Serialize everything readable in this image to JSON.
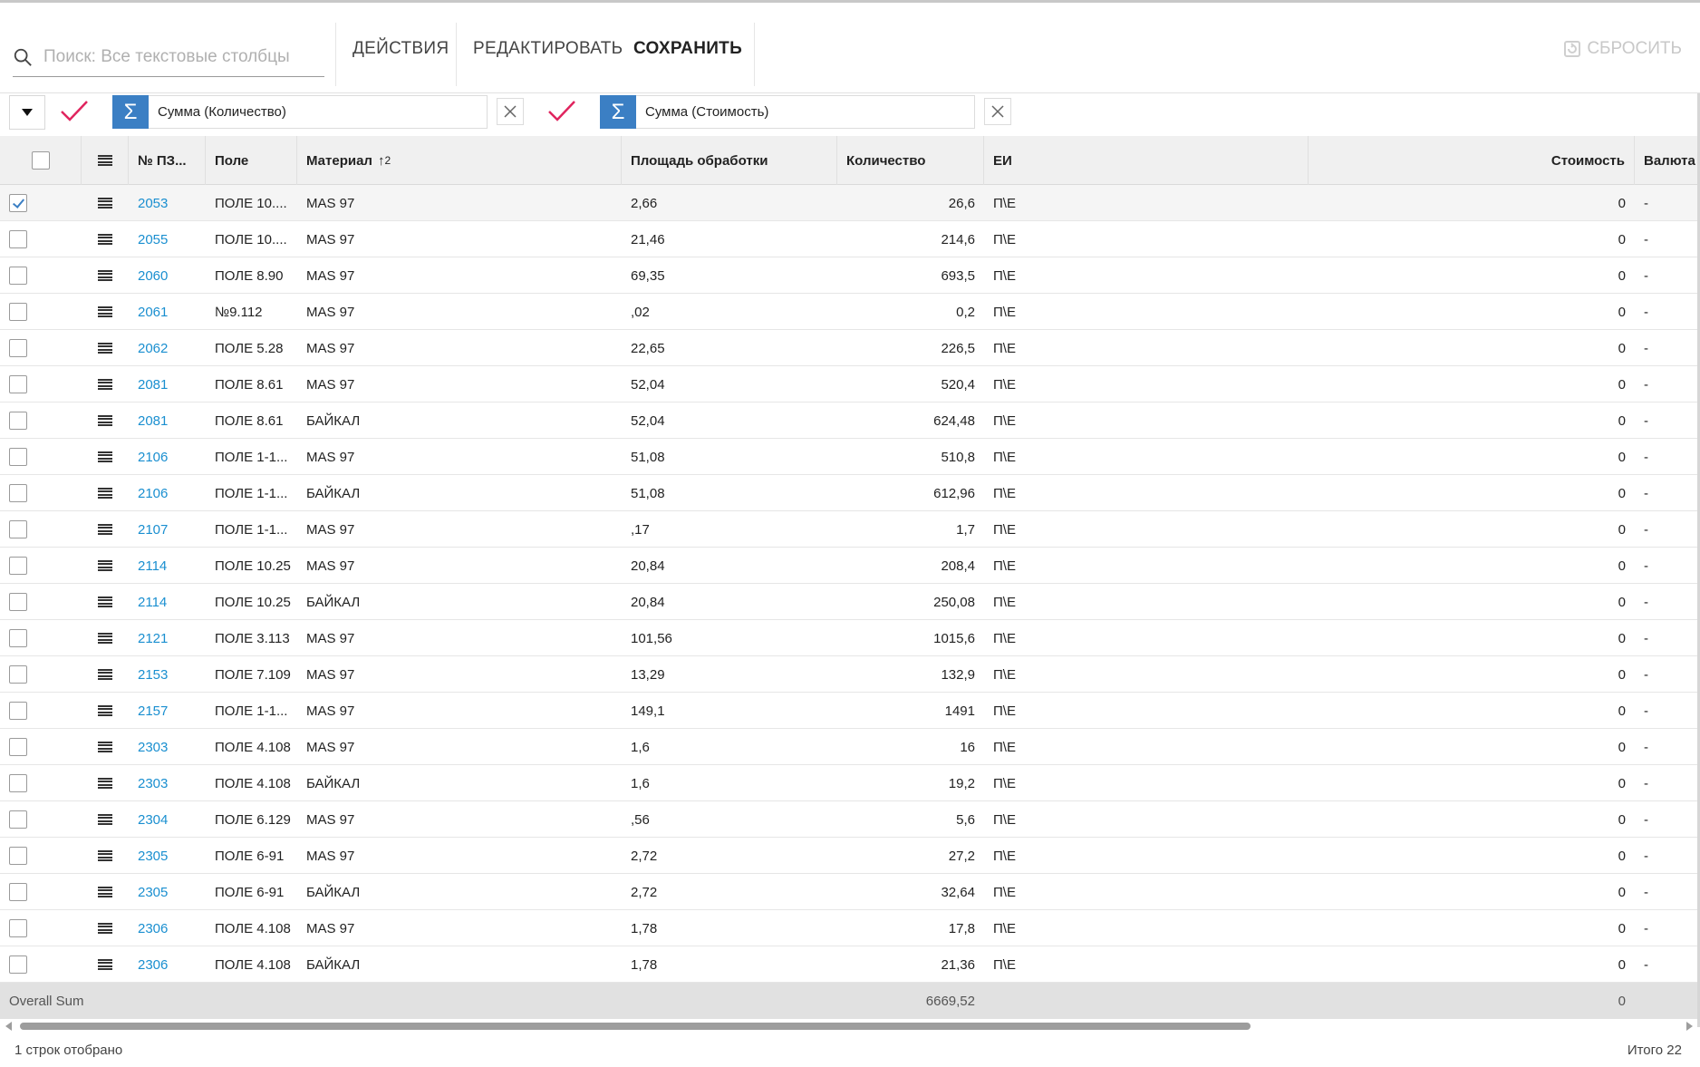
{
  "search": {
    "placeholder": "Поиск: Все текстовые столбцы"
  },
  "toolbar": {
    "actions_label": "ДЕЙСТВИЯ",
    "edit_label": "РЕДАКТИРОВАТЬ",
    "save_label": "СОХРАНИТЬ",
    "reset_label": "СБРОСИТЬ"
  },
  "aggregates": [
    {
      "label": "Сумма (Количество)"
    },
    {
      "label": "Сумма (Стоимость)"
    }
  ],
  "columns": {
    "doc_no": "№ ПЗ...",
    "field": "Поле",
    "material": "Материал",
    "material_sort": "2",
    "area": "Площадь обработки",
    "qty": "Количество",
    "unit": "ЕИ",
    "cost": "Стоимость",
    "currency": "Валюта"
  },
  "rows": [
    {
      "no": "2053",
      "field": "ПОЛЕ 10....",
      "material": "MAS 97",
      "area": "2,66",
      "qty": "26,6",
      "unit": "П\\Е",
      "cost": "0",
      "currency": "-",
      "checked": true
    },
    {
      "no": "2055",
      "field": "ПОЛЕ 10....",
      "material": "MAS 97",
      "area": "21,46",
      "qty": "214,6",
      "unit": "П\\Е",
      "cost": "0",
      "currency": "-",
      "checked": false
    },
    {
      "no": "2060",
      "field": "ПОЛЕ 8.90",
      "material": "MAS 97",
      "area": "69,35",
      "qty": "693,5",
      "unit": "П\\Е",
      "cost": "0",
      "currency": "-",
      "checked": false
    },
    {
      "no": "2061",
      "field": "№9.112",
      "material": "MAS 97",
      "area": ",02",
      "qty": "0,2",
      "unit": "П\\Е",
      "cost": "0",
      "currency": "-",
      "checked": false
    },
    {
      "no": "2062",
      "field": "ПОЛЕ 5.28",
      "material": "MAS 97",
      "area": "22,65",
      "qty": "226,5",
      "unit": "П\\Е",
      "cost": "0",
      "currency": "-",
      "checked": false
    },
    {
      "no": "2081",
      "field": "ПОЛЕ 8.61",
      "material": "MAS 97",
      "area": "52,04",
      "qty": "520,4",
      "unit": "П\\Е",
      "cost": "0",
      "currency": "-",
      "checked": false
    },
    {
      "no": "2081",
      "field": "ПОЛЕ 8.61",
      "material": "БАЙКАЛ",
      "area": "52,04",
      "qty": "624,48",
      "unit": "П\\Е",
      "cost": "0",
      "currency": "-",
      "checked": false
    },
    {
      "no": "2106",
      "field": "ПОЛЕ 1-1...",
      "material": "MAS 97",
      "area": "51,08",
      "qty": "510,8",
      "unit": "П\\Е",
      "cost": "0",
      "currency": "-",
      "checked": false
    },
    {
      "no": "2106",
      "field": "ПОЛЕ 1-1...",
      "material": "БАЙКАЛ",
      "area": "51,08",
      "qty": "612,96",
      "unit": "П\\Е",
      "cost": "0",
      "currency": "-",
      "checked": false
    },
    {
      "no": "2107",
      "field": "ПОЛЕ 1-1...",
      "material": "MAS 97",
      "area": ",17",
      "qty": "1,7",
      "unit": "П\\Е",
      "cost": "0",
      "currency": "-",
      "checked": false
    },
    {
      "no": "2114",
      "field": "ПОЛЕ 10.25",
      "material": "MAS 97",
      "area": "20,84",
      "qty": "208,4",
      "unit": "П\\Е",
      "cost": "0",
      "currency": "-",
      "checked": false
    },
    {
      "no": "2114",
      "field": "ПОЛЕ 10.25",
      "material": "БАЙКАЛ",
      "area": "20,84",
      "qty": "250,08",
      "unit": "П\\Е",
      "cost": "0",
      "currency": "-",
      "checked": false
    },
    {
      "no": "2121",
      "field": "ПОЛЕ 3.113",
      "material": "MAS 97",
      "area": "101,56",
      "qty": "1015,6",
      "unit": "П\\Е",
      "cost": "0",
      "currency": "-",
      "checked": false
    },
    {
      "no": "2153",
      "field": "ПОЛЕ 7.109",
      "material": "MAS 97",
      "area": "13,29",
      "qty": "132,9",
      "unit": "П\\Е",
      "cost": "0",
      "currency": "-",
      "checked": false
    },
    {
      "no": "2157",
      "field": "ПОЛЕ 1-1...",
      "material": "MAS 97",
      "area": "149,1",
      "qty": "1491",
      "unit": "П\\Е",
      "cost": "0",
      "currency": "-",
      "checked": false
    },
    {
      "no": "2303",
      "field": "ПОЛЕ 4.108",
      "material": "MAS 97",
      "area": "1,6",
      "qty": "16",
      "unit": "П\\Е",
      "cost": "0",
      "currency": "-",
      "checked": false
    },
    {
      "no": "2303",
      "field": "ПОЛЕ 4.108",
      "material": "БАЙКАЛ",
      "area": "1,6",
      "qty": "19,2",
      "unit": "П\\Е",
      "cost": "0",
      "currency": "-",
      "checked": false
    },
    {
      "no": "2304",
      "field": "ПОЛЕ 6.129",
      "material": "MAS 97",
      "area": ",56",
      "qty": "5,6",
      "unit": "П\\Е",
      "cost": "0",
      "currency": "-",
      "checked": false
    },
    {
      "no": "2305",
      "field": "ПОЛЕ 6-91",
      "material": "MAS 97",
      "area": "2,72",
      "qty": "27,2",
      "unit": "П\\Е",
      "cost": "0",
      "currency": "-",
      "checked": false
    },
    {
      "no": "2305",
      "field": "ПОЛЕ 6-91",
      "material": "БАЙКАЛ",
      "area": "2,72",
      "qty": "32,64",
      "unit": "П\\Е",
      "cost": "0",
      "currency": "-",
      "checked": false
    },
    {
      "no": "2306",
      "field": "ПОЛЕ 4.108",
      "material": "MAS 97",
      "area": "1,78",
      "qty": "17,8",
      "unit": "П\\Е",
      "cost": "0",
      "currency": "-",
      "checked": false
    },
    {
      "no": "2306",
      "field": "ПОЛЕ 4.108",
      "material": "БАЙКАЛ",
      "area": "1,78",
      "qty": "21,36",
      "unit": "П\\Е",
      "cost": "0",
      "currency": "-",
      "checked": false
    }
  ],
  "totals": {
    "label": "Overall Sum",
    "qty": "6669,52",
    "cost": "0"
  },
  "status": {
    "selected": "1 строк отобрано",
    "total": "Итого 22"
  },
  "colors": {
    "accent": "#3b7fc4",
    "link": "#1a8fd0",
    "check": "#e0245e"
  }
}
